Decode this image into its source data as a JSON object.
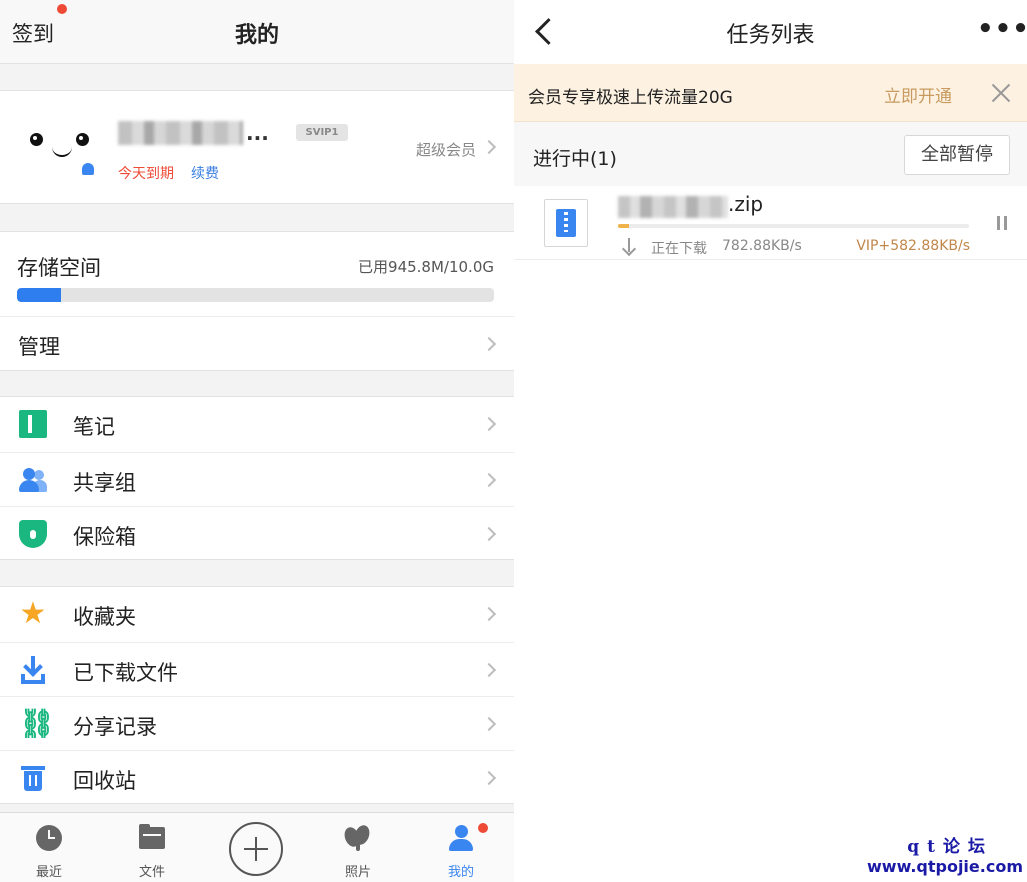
{
  "left": {
    "header": {
      "checkin_label": "签到",
      "title": "我的"
    },
    "profile": {
      "name_suffix": "...",
      "badge": "SVIP1",
      "expire_text": "今天到期",
      "renew_label": "续费",
      "member_level": "超级会员"
    },
    "storage": {
      "title": "存储空间",
      "used_text": "已用945.8M/10.0G",
      "used_fraction": 0.092,
      "manage_label": "管理"
    },
    "menu_group_1": [
      {
        "label": "笔记",
        "icon": "note-icon"
      },
      {
        "label": "共享组",
        "icon": "share-group-icon"
      },
      {
        "label": "保险箱",
        "icon": "safe-icon"
      }
    ],
    "menu_group_2": [
      {
        "label": "收藏夹",
        "icon": "star-icon"
      },
      {
        "label": "已下载文件",
        "icon": "download-icon"
      },
      {
        "label": "分享记录",
        "icon": "link-icon"
      },
      {
        "label": "回收站",
        "icon": "trash-icon"
      }
    ],
    "bottom_nav": [
      {
        "label": "最近",
        "icon": "clock-icon",
        "active": false
      },
      {
        "label": "文件",
        "icon": "folder-icon",
        "active": false
      },
      {
        "label": "",
        "icon": "add-icon",
        "active": false
      },
      {
        "label": "照片",
        "icon": "photo-icon",
        "active": false
      },
      {
        "label": "我的",
        "icon": "user-icon",
        "active": true
      }
    ]
  },
  "right": {
    "header": {
      "title": "任务列表",
      "more": "•••"
    },
    "promo": {
      "text": "会员专享极速上传流量20G",
      "action_label": "立即开通"
    },
    "section": {
      "title": "进行中(1)",
      "pause_all_label": "全部暂停"
    },
    "tasks": [
      {
        "file_suffix": ".zip",
        "progress_fraction": 0.03,
        "status": "正在下载",
        "speed": "782.88KB/s",
        "vip_speed": "VIP+582.88KB/s"
      }
    ]
  },
  "watermark": {
    "line1": "qt论坛",
    "line2": "www.qtpojie.com"
  },
  "colors": {
    "accent": "#3a86f0",
    "green": "#1bb780",
    "alert": "#ee4a36",
    "gold": "#c89a5f",
    "promo_bg": "#fdf2e2"
  }
}
